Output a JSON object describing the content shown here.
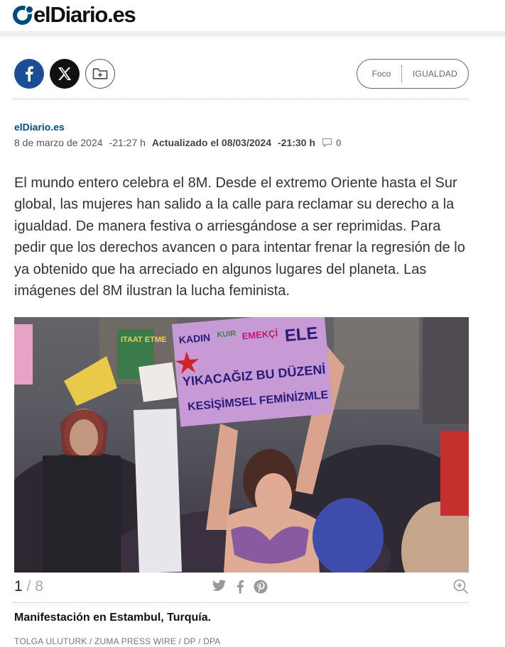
{
  "header": {
    "logo_text": "elDiario.es"
  },
  "share": {
    "facebook_icon": "facebook-icon",
    "x_icon": "x-icon",
    "save_icon": "folder-add-icon"
  },
  "tags": {
    "section": "Foco",
    "topic": "IGUALDAD"
  },
  "byline": {
    "author": "elDiario.es",
    "date": "8 de marzo de 2024",
    "time": "-21:27 h",
    "updated_label": "Actualizado el 08/03/2024",
    "updated_time": "-21:30 h",
    "comment_count": "0"
  },
  "article": {
    "lead": "El mundo entero celebra el 8M. Desde el extremo Oriente hasta el Sur global, las mujeres han salido a la calle para reclamar su derecho a la igualdad. De manera festiva o arriesgándose a ser reprimidas. Para pedir que los derechos avancen o para intentar frenar la regresión de lo ya obtenido que ha arreciado en algunos lugares del planeta. Las imágenes del 8M ilustran la lucha feminista."
  },
  "gallery": {
    "current": "1",
    "separator": "/",
    "total": "8",
    "caption": "Manifestación en Estambul, Turquía.",
    "credit": "TOLGA ULUTURK / ZUMA PRESS WIRE / DP / DPA",
    "sign_lines": [
      "KADIN",
      "KUIR",
      "EMEKÇİ",
      "ELE",
      "YIKACAĞIZ BU DÜZENİ",
      "KESİŞİMSEL FEMİNİZMLE"
    ],
    "banner_text": "ITAAT ETME",
    "colors": {
      "brand": "#004a7c",
      "sign": "#c79ad6",
      "sign_text": "#2b1b78"
    }
  }
}
